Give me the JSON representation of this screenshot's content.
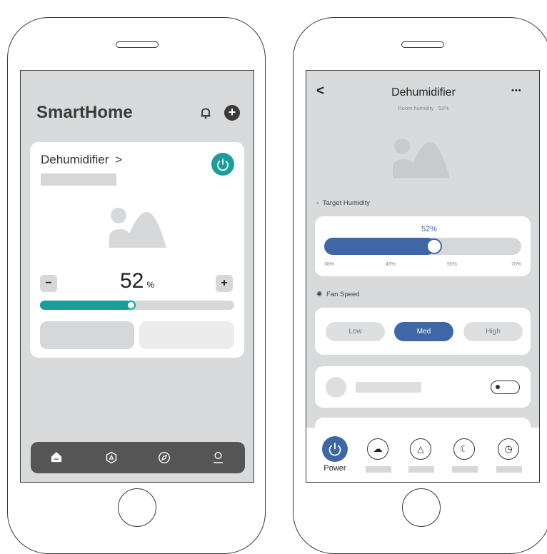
{
  "left": {
    "app_title": "SmartHome",
    "device_name": "Dehumidifier",
    "chevron": ">",
    "minus_label": "−",
    "plus_label": "+",
    "humidity_value": "52",
    "humidity_unit": "%",
    "slider_fraction": 0.45,
    "accent_color": "#1a9e9a",
    "nav_items": [
      "home-icon",
      "scene-icon",
      "discover-icon",
      "profile-icon"
    ]
  },
  "right": {
    "back_label": "<",
    "title": "Dehumidifier",
    "subtitle": "Room humidity   52%",
    "more_label": "•••",
    "target_section_label": "Target Humidity",
    "target_value_label": "52%",
    "target_fraction": 0.52,
    "slider_ticks": [
      "38%",
      "45%",
      "55%",
      "70%"
    ],
    "fan_section_label": "Fan Speed",
    "fan_options": [
      "Low",
      "Med",
      "High"
    ],
    "fan_selected": "Med",
    "accent_color": "#3f67a8",
    "power_label": "Power",
    "bottom_icons": [
      "power-icon",
      "mode-icon",
      "drain-icon",
      "sleep-icon",
      "timer-icon"
    ]
  }
}
